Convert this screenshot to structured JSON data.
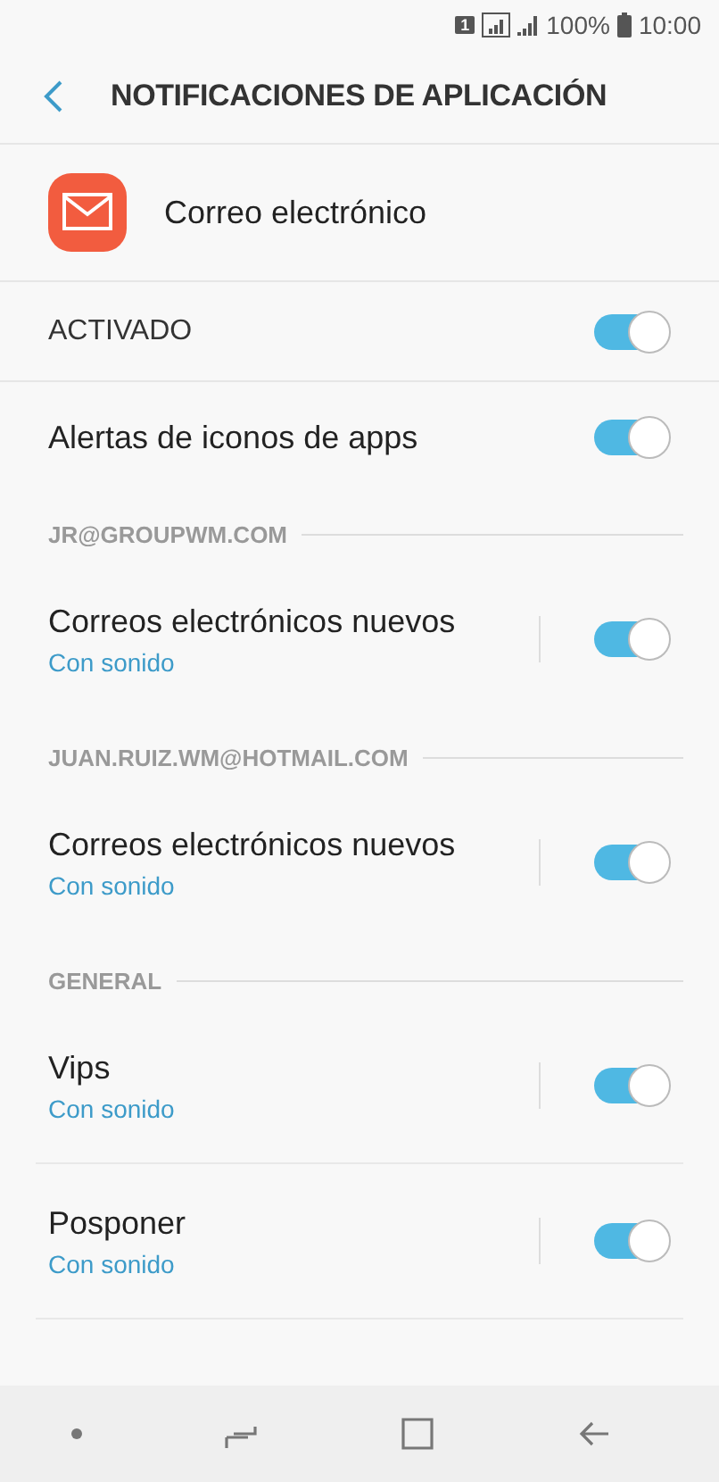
{
  "status_bar": {
    "sim": "1",
    "battery": "100%",
    "time": "10:00"
  },
  "header": {
    "title": "NOTIFICACIONES DE APLICACIÓN"
  },
  "app": {
    "name": "Correo electrónico"
  },
  "items": [
    {
      "kind": "master",
      "label": "ACTIVADO",
      "on": true
    },
    {
      "kind": "toggle",
      "label": "Alertas de iconos de apps",
      "on": true
    },
    {
      "kind": "section",
      "label": "JR@GROUPWM.COM"
    },
    {
      "kind": "sub_toggle",
      "label": "Correos electrónicos nuevos",
      "subtitle": "Con sonido",
      "on": true
    },
    {
      "kind": "section",
      "label": "JUAN.RUIZ.WM@HOTMAIL.COM"
    },
    {
      "kind": "sub_toggle",
      "label": "Correos electrónicos nuevos",
      "subtitle": "Con sonido",
      "on": true
    },
    {
      "kind": "section",
      "label": "GENERAL"
    },
    {
      "kind": "sub_toggle",
      "label": "Vips",
      "subtitle": "Con sonido",
      "on": true,
      "divider": true
    },
    {
      "kind": "sub_toggle",
      "label": "Posponer",
      "subtitle": "Con sonido",
      "on": true,
      "divider": true
    }
  ]
}
